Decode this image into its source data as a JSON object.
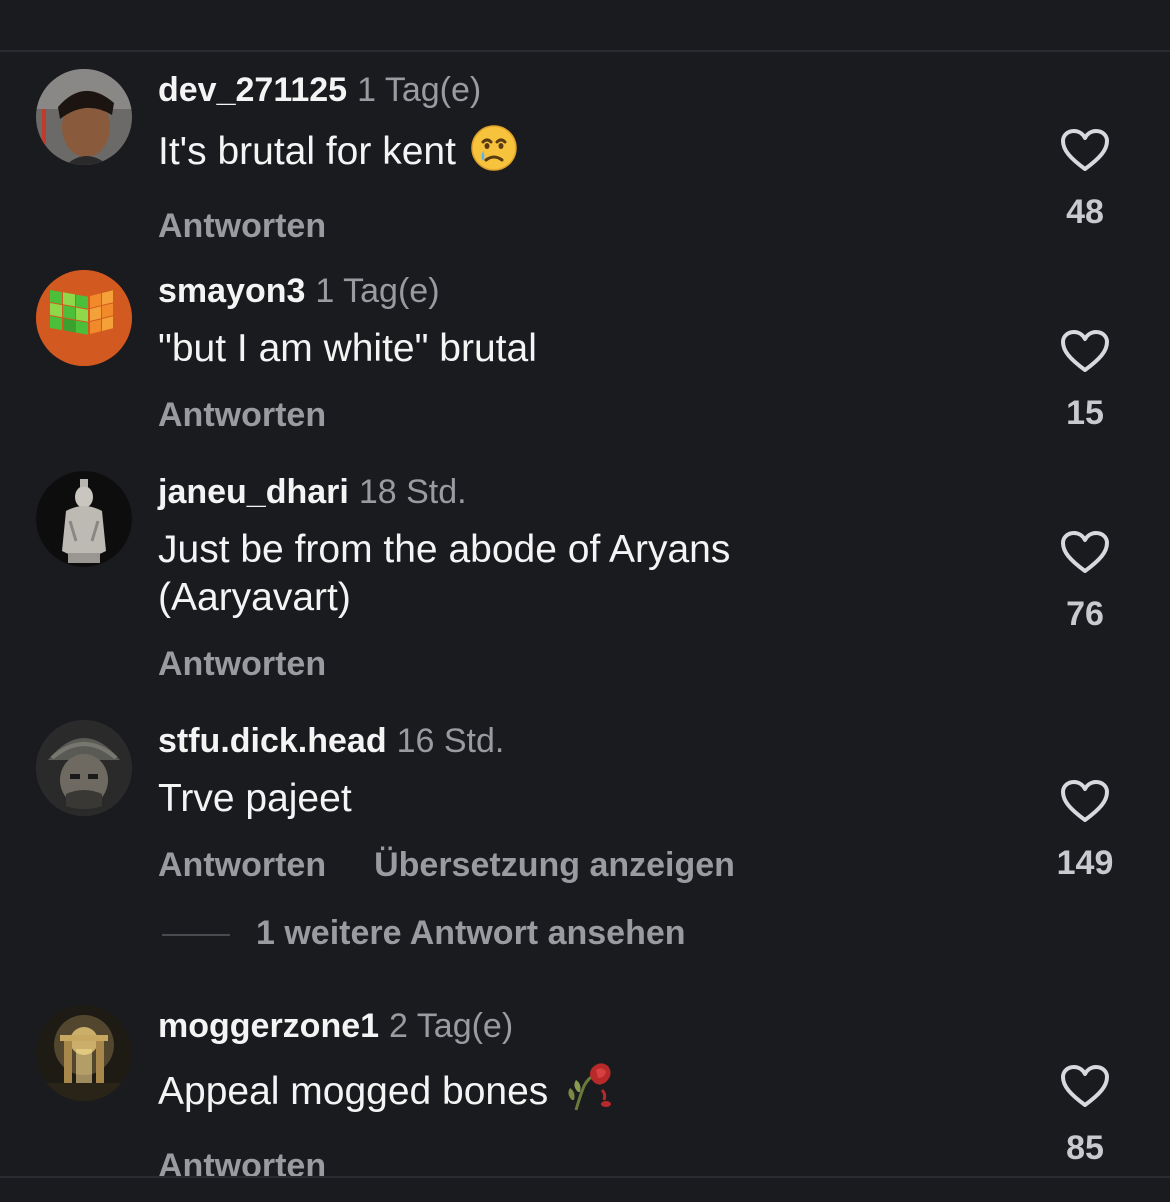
{
  "comments": [
    {
      "username": "dev_271125",
      "time": "1 Tag(e)",
      "text": "It's brutal for kent",
      "emoji": "crying-face",
      "reply_label": "Antworten",
      "likes": "48",
      "avatar_icon": "profile-photo"
    },
    {
      "username": "smayon3",
      "time": "1 Tag(e)",
      "text": "\"but I am white\" brutal",
      "reply_label": "Antworten",
      "likes": "15",
      "avatar_icon": "rubiks-cube-photo"
    },
    {
      "username": "janeu_dhari",
      "time": "18 Std.",
      "text": "Just be from the abode of Aryans (Aaryavart)",
      "reply_label": "Antworten",
      "likes": "76",
      "avatar_icon": "statue-photo"
    },
    {
      "username": "stfu.dick.head",
      "time": "16 Std.",
      "text": "Trve pajeet",
      "reply_label": "Antworten",
      "translate_label": "Übersetzung anzeigen",
      "likes": "149",
      "more_replies": "1 weitere Antwort ansehen",
      "avatar_icon": "soldier-photo"
    },
    {
      "username": "moggerzone1",
      "time": "2 Tag(e)",
      "text": "Appeal mogged bones",
      "emoji": "wilted-rose",
      "reply_label": "Antworten",
      "likes": "85",
      "avatar_icon": "gate-photo"
    }
  ],
  "colors": {
    "background": "#1a1b1f",
    "primary_text": "#f4f4f4",
    "secondary_text": "#9a9ba1"
  }
}
